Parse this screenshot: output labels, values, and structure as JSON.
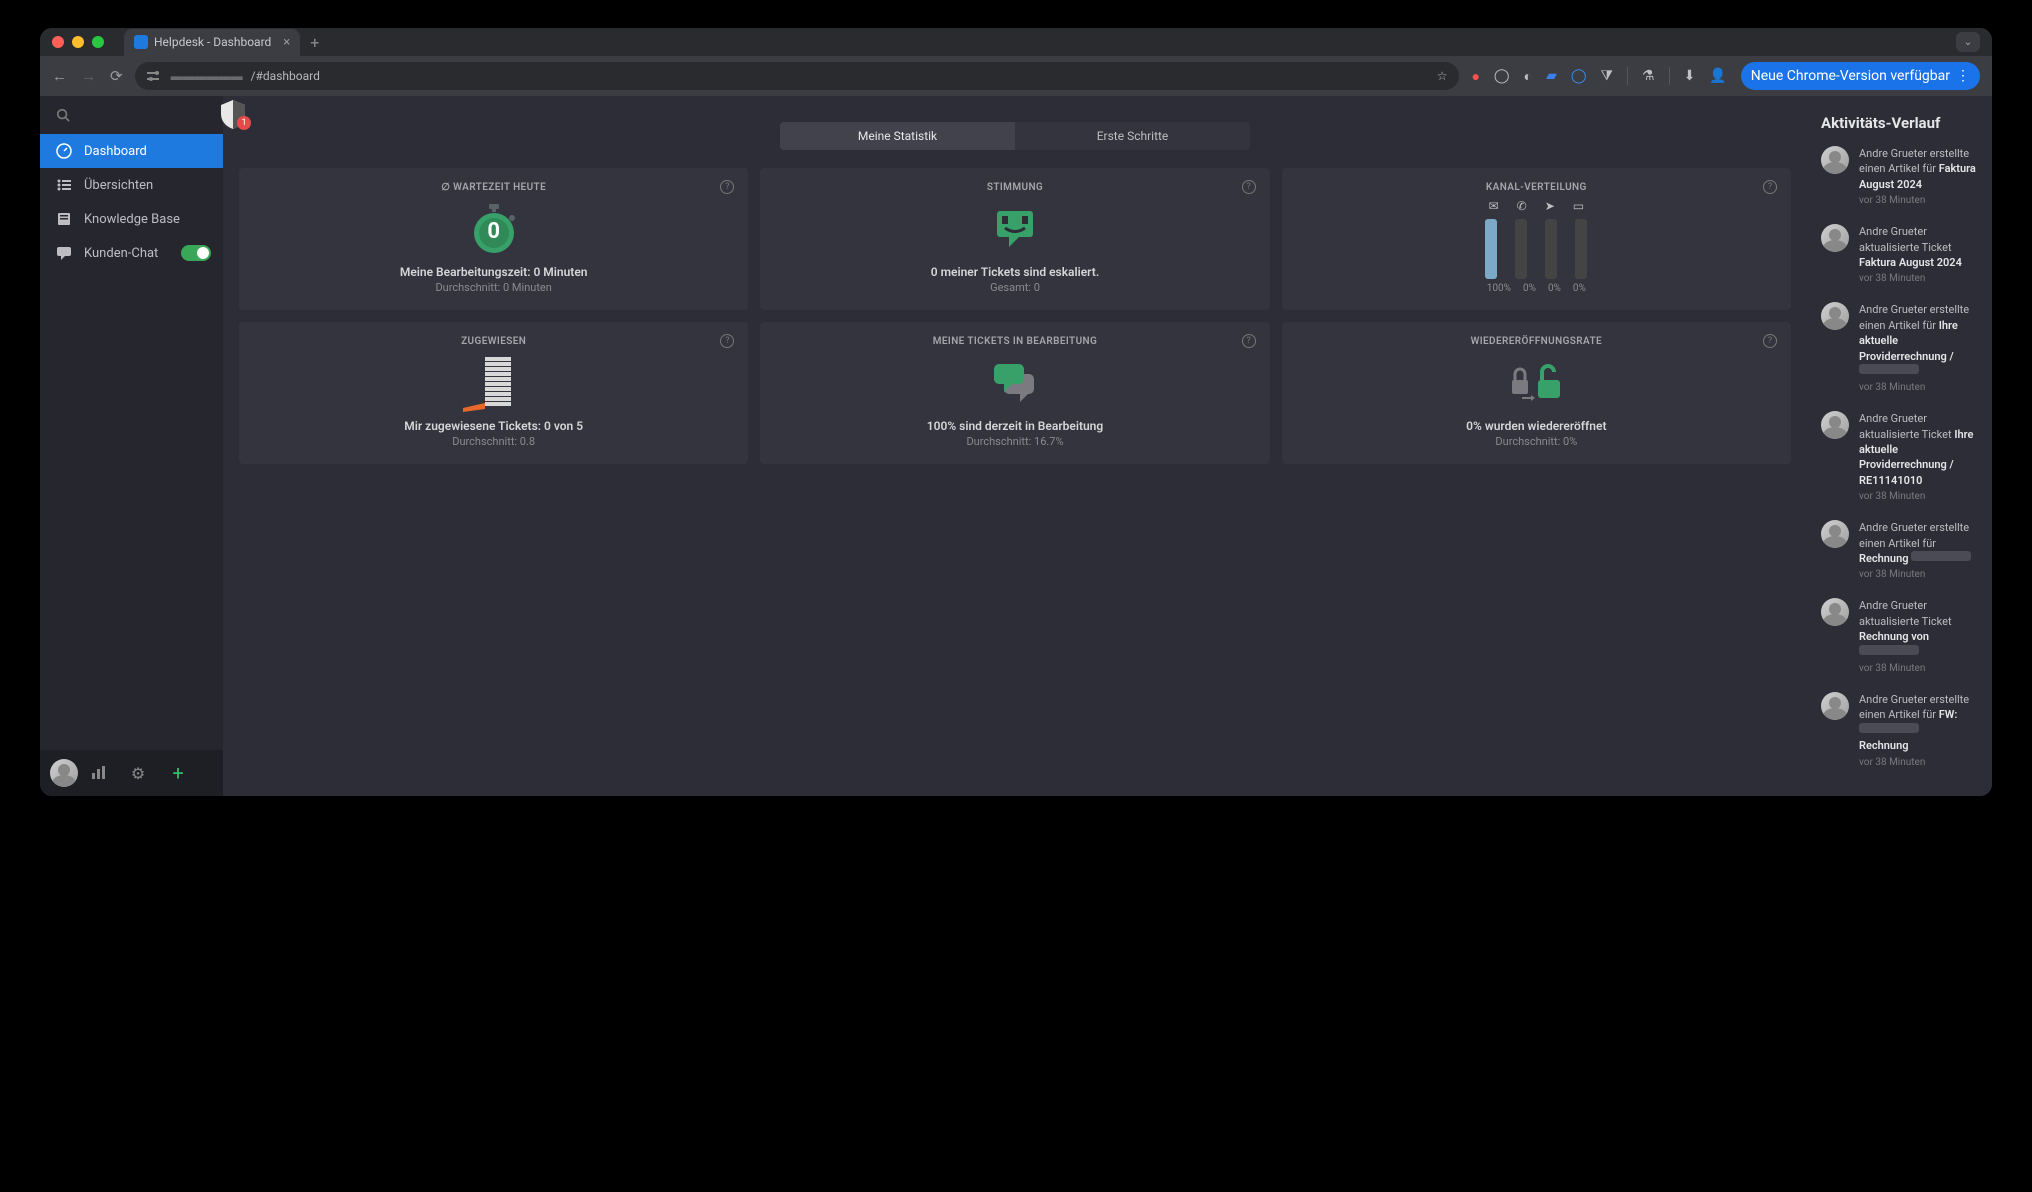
{
  "browser": {
    "tab_title": "Helpdesk - Dashboard",
    "url": "/#dashboard",
    "update_button": "Neue Chrome-Version verfügbar",
    "star": "☆"
  },
  "sidebar": {
    "badge_count": "1",
    "items": [
      {
        "label": "Dashboard"
      },
      {
        "label": "Übersichten"
      },
      {
        "label": "Knowledge Base"
      },
      {
        "label": "Kunden-Chat"
      }
    ]
  },
  "tabs": {
    "stats": "Meine Statistik",
    "first_steps": "Erste Schritte"
  },
  "cards": {
    "wait": {
      "title": "∅ WARTEZEIT HEUTE",
      "value": "0",
      "line": "Meine Bearbeitungszeit: 0 Minuten",
      "sub": "Durchschnitt: 0 Minuten"
    },
    "mood": {
      "title": "STIMMUNG",
      "line": "0 meiner Tickets sind eskaliert.",
      "sub": "Gesamt: 0"
    },
    "channel": {
      "title": "KANAL-VERTEILUNG",
      "pcts": [
        "100%",
        "0%",
        "0%",
        "0%"
      ]
    },
    "assigned": {
      "title": "ZUGEWIESEN",
      "line": "Mir zugewiesene Tickets: 0 von 5",
      "sub": "Durchschnitt: 0.8"
    },
    "processing": {
      "title": "MEINE TICKETS IN BEARBEITUNG",
      "line": "100% sind derzeit in Bearbeitung",
      "sub": "Durchschnitt: 16.7%"
    },
    "reopen": {
      "title": "WIEDERERÖFFNUNGSRATE",
      "line": "0% wurden wiedereröffnet",
      "sub": "Durchschnitt: 0%"
    }
  },
  "rail": {
    "title": "Aktivitäts-Verlauf",
    "items": [
      {
        "prefix": "Andre Grueter erstellte einen Artikel für ",
        "bold": "Faktura August 2024",
        "time": "vor 38 Minuten"
      },
      {
        "prefix": "Andre Grueter aktualisierte Ticket ",
        "bold": "Faktura August 2024",
        "time": "vor 38 Minuten"
      },
      {
        "prefix": "Andre Grueter erstellte einen Artikel für ",
        "bold": "Ihre aktuelle Providerrechnung / ",
        "blur": true,
        "time": "vor 38 Minuten"
      },
      {
        "prefix": "Andre Grueter aktualisierte Ticket ",
        "bold": "Ihre aktuelle Providerrechnung / RE11141010",
        "time": "vor 38 Minuten"
      },
      {
        "prefix": "Andre Grueter erstellte einen Artikel für ",
        "bold": "Rechnung",
        "blur": true,
        "time": "vor 38 Minuten"
      },
      {
        "prefix": "Andre Grueter aktualisierte Ticket ",
        "bold": "Rechnung von",
        "blur": true,
        "time": "vor 38 Minuten"
      },
      {
        "prefix": "Andre Grueter erstellte einen Artikel für ",
        "bold": "FW:",
        "blur": true,
        "extra": "Rechnung",
        "time": "vor 38 Minuten"
      }
    ]
  },
  "chart_data": {
    "type": "bar",
    "title": "Kanal-Verteilung",
    "categories": [
      "email",
      "phone",
      "twitter",
      "chat"
    ],
    "values": [
      100,
      0,
      0,
      0
    ],
    "ylim": [
      0,
      100
    ],
    "unit": "%"
  }
}
